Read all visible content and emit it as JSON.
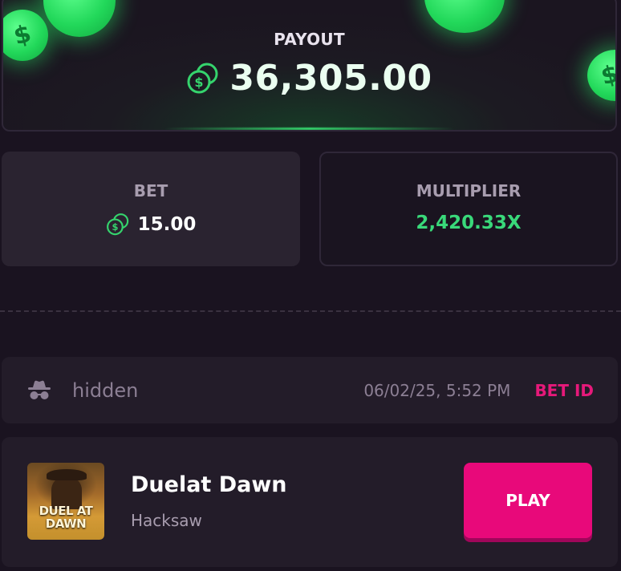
{
  "payout": {
    "label": "PAYOUT",
    "amount": "36,305.00"
  },
  "bet": {
    "label": "BET",
    "amount": "15.00"
  },
  "multiplier": {
    "label": "MULTIPLIER",
    "value": "2,420.33X"
  },
  "bet_info": {
    "username": "hidden",
    "timestamp": "06/02/25, 5:52 PM",
    "bet_id_label": "BET ID"
  },
  "game": {
    "title": "Duelat Dawn",
    "provider": "Hacksaw",
    "thumbnail_text": "DUEL AT DAWN",
    "play_label": "PLAY"
  },
  "icons": {
    "currency": "coins-icon",
    "user": "incognito-icon",
    "falling_coin": "dollar-coin-icon"
  },
  "colors": {
    "accent_green": "#39d97a",
    "accent_pink": "#e8097a",
    "bet_id_pink": "#e6197a",
    "background": "#1a1320"
  }
}
